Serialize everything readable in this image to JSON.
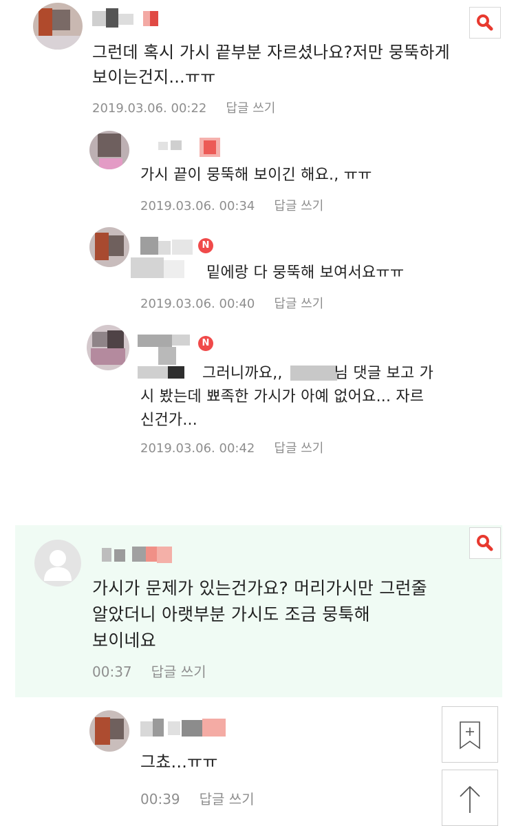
{
  "comments": [
    {
      "text_line1": "그런데 혹시 가시 끝부분 자르셨나요?저만 뭉뚝하게",
      "text_line2": "보이는건지...ㅠㅠ",
      "date": "2019.03.06. 00:22",
      "reply_label": "답글 쓰기",
      "badge": "",
      "replies": [
        {
          "text": "가시 끝이 뭉뚝해 보이긴 해요., ㅠㅠ",
          "date": "2019.03.06. 00:34",
          "reply_label": "답글 쓰기"
        },
        {
          "text": "밑에랑 다 뭉뚝해 보여서요ㅠㅠ",
          "date": "2019.03.06. 00:40",
          "reply_label": "답글 쓰기",
          "badge": "N"
        },
        {
          "text_line1a": "그러니까요,,",
          "text_line1b": "님 댓글 보고 가",
          "text_line2": "시 봤는데 뾰족한 가시가 아예 없어요... 자르",
          "text_line3": "신건가...",
          "date": "2019.03.06. 00:42",
          "reply_label": "답글 쓰기",
          "badge": "N"
        }
      ]
    },
    {
      "text_line1": "가시가 문제가 있는건가요? 머리가시만 그런줄",
      "text_line2": "알았더니 아랫부분 가시도 조금 뭉툭해",
      "text_line3": "보이네요",
      "date": "00:37",
      "reply_label": "답글 쓰기",
      "replies": [
        {
          "text": "그쵸...ㅠㅠ",
          "date": "00:39",
          "reply_label": "답글 쓰기"
        }
      ]
    }
  ],
  "icons": {
    "search": "search-icon",
    "bookmark": "bookmark-add-icon",
    "scroll_top": "arrow-up-icon",
    "avatar_default": "default-avatar-icon"
  },
  "colors": {
    "accent": "#e8392f",
    "meta": "#8e8e8e",
    "highlight_bg": "#f0fbf4",
    "badge": "#f04a4a"
  }
}
